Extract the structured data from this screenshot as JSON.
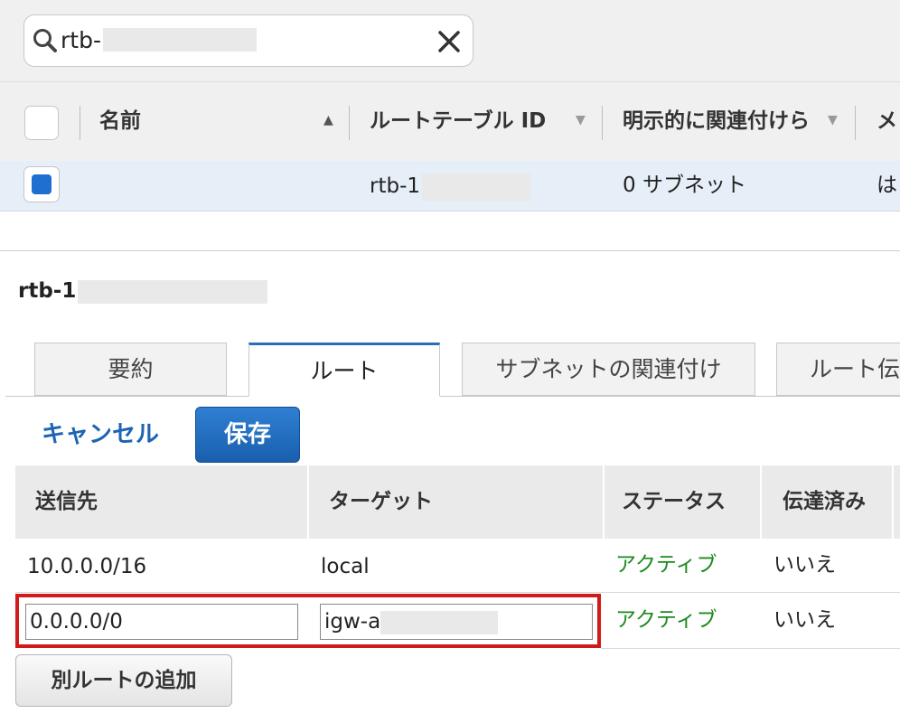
{
  "search": {
    "value": "rtb-"
  },
  "route_table_list": {
    "columns": {
      "name": "名前",
      "route_table_id": "ルートテーブル ID",
      "explicit_assoc": "明示的に関連付けら",
      "partial": "メ"
    },
    "rows": [
      {
        "selected": true,
        "name": "",
        "route_table_id": "rtb-1",
        "explicit_assoc": "0 サブネット",
        "partial": "は"
      }
    ]
  },
  "detail": {
    "title": "rtb-1",
    "tabs": [
      "要約",
      "ルート",
      "サブネットの関連付け",
      "ルート伝"
    ],
    "active_tab": "ルート"
  },
  "actions": {
    "cancel_label": "キャンセル",
    "save_label": "保存",
    "add_route_label": "別ルートの追加"
  },
  "routes": {
    "columns": [
      "送信先",
      "ターゲット",
      "ステータス",
      "伝達済み"
    ],
    "rows": [
      {
        "destination": "10.0.0.0/16",
        "target": "local",
        "status": "アクティブ",
        "propagated": "いいえ"
      },
      {
        "destination": "0.0.0.0/0",
        "target": "igw-a",
        "status": "アクティブ",
        "propagated": "いいえ",
        "editing": true
      }
    ]
  },
  "colors": {
    "accent": "#2a6ebb",
    "link": "#1d64b5",
    "status_active": "#1e8a1e",
    "highlight_frame": "#d11a1a"
  },
  "icons": {
    "search": "search-icon",
    "clear": "close-icon",
    "sort_asc": "sort-ascending-icon",
    "sort_caret": "chevron-down-icon"
  }
}
